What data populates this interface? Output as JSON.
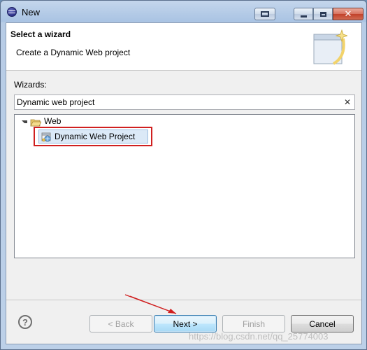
{
  "window": {
    "title": "New",
    "icon": "eclipse-icon"
  },
  "header": {
    "title": "Select a wizard",
    "description": "Create a Dynamic Web project"
  },
  "wizards": {
    "label": "Wizards:",
    "filter_value": "Dynamic web project",
    "tree": [
      {
        "label": "Web",
        "expanded": true,
        "icon": "folder-open-icon",
        "children": [
          {
            "label": "Dynamic Web Project",
            "icon": "dynamic-web-project-icon",
            "selected": true
          }
        ]
      }
    ]
  },
  "footer": {
    "back_label": "< Back",
    "next_label": "Next >",
    "finish_label": "Finish",
    "cancel_label": "Cancel"
  },
  "colors": {
    "highlight_frame": "#d02020",
    "selection_bg": "#dbe9f7",
    "next_button_border": "#3c7fb1"
  },
  "watermark": "https://blog.csdn.net/qq_25774003"
}
